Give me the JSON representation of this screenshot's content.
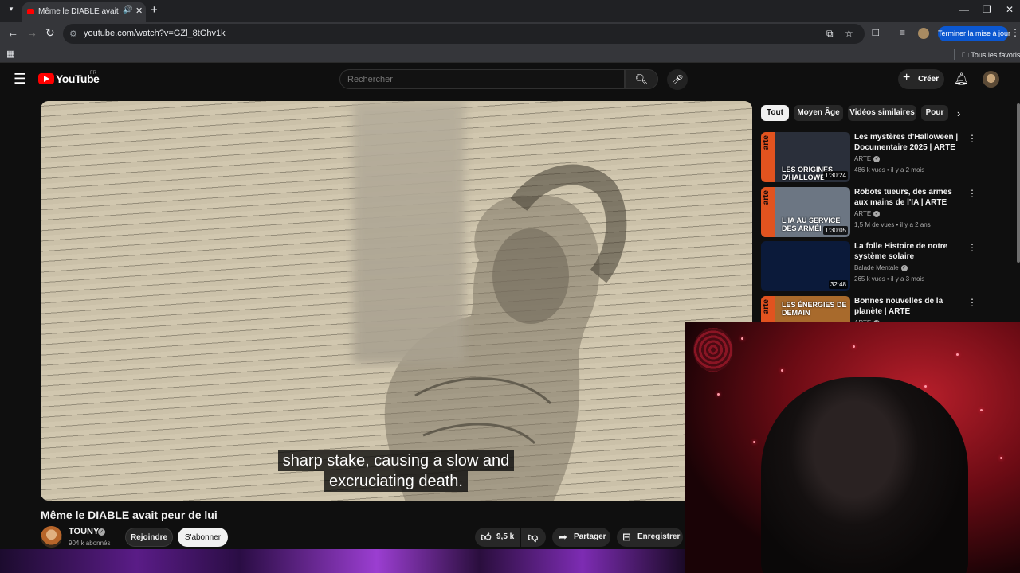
{
  "browser": {
    "tab_title": "Même le DIABLE avait peur de lui",
    "url": "youtube.com/watch?v=GZl_8tGhv1k",
    "update_label": "Terminer la mise à jour",
    "all_bookmarks_label": "Tous les favoris"
  },
  "header": {
    "logo_text": "YouTube",
    "region": "FR",
    "search_placeholder": "Rechercher",
    "create_label": "Créer"
  },
  "video": {
    "subtitle_line1": "sharp stake, causing a slow and",
    "subtitle_line2": "excruciating death.",
    "title": "Même le DIABLE avait peur de lui",
    "channel": "TOUNY",
    "subscribers": "904 k abonnés",
    "join_label": "Rejoindre",
    "subscribe_label": "S'abonner",
    "likes": "9,5 k",
    "share_label": "Partager",
    "save_label": "Enregistrer"
  },
  "chips": [
    "Tout",
    "Moyen Âge",
    "Vidéos similaires",
    "Pour"
  ],
  "related": [
    {
      "title": "Les mystères d'Halloween | Documentaire 2025 | ARTE",
      "channel": "ARTE",
      "views": "486 k vues",
      "age": "il y a 2 mois",
      "duration": "1:30:24",
      "thumb_brand": "arte",
      "thumb_caption": "LES ORIGINES D'HALLOWE",
      "thumb_bg": "#2a2f3a"
    },
    {
      "title": "Robots tueurs, des armes aux mains de l'IA | ARTE",
      "channel": "ARTE",
      "views": "1,5 M de vues",
      "age": "il y a 2 ans",
      "duration": "1:30:05",
      "thumb_brand": "arte",
      "thumb_caption": "L'IA AU SERVICE DES ARMÉI",
      "thumb_bg": "#6c7683"
    },
    {
      "title": "La folle Histoire de notre système solaire",
      "channel": "Balade Mentale",
      "views": "265 k vues",
      "age": "il y a 3 mois",
      "duration": "32:48",
      "thumb_brand": "",
      "thumb_caption": "",
      "thumb_bg": "#0b1a3a"
    },
    {
      "title": "Bonnes nouvelles de la planète | ARTE",
      "channel": "ARTE",
      "views": "",
      "age": "",
      "duration": "",
      "thumb_brand": "arte",
      "thumb_caption": "LES ÉNERGIES DE DEMAIN",
      "thumb_bg": "#a86a2c"
    }
  ],
  "colors": {
    "background": "#0f0f0f",
    "brand_red": "#ff0000",
    "arte_orange": "#e2531f",
    "update_blue": "#0b57d0"
  }
}
